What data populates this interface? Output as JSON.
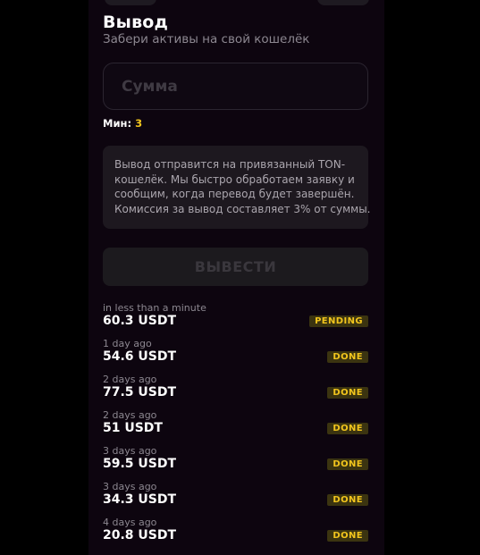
{
  "header": {
    "title": "Вывод",
    "subtitle": "Забери активы на свой кошелёк"
  },
  "amount_input": {
    "placeholder": "Сумма",
    "value": ""
  },
  "min": {
    "label": "Мин:",
    "value": "3"
  },
  "info": {
    "lines": [
      "Вывод отправится на привязанный TON-",
      "кошелёк. Мы быстро обработаем заявку и",
      "сообщим, когда перевод будет завершён.",
      "Комиссия за вывод составляет 3% от суммы."
    ]
  },
  "withdraw_button": {
    "label": "ВЫВЕСТИ"
  },
  "history": [
    {
      "time": "in less than a minute",
      "amount": "60.3 USDT",
      "status": "PENDING"
    },
    {
      "time": "1 day ago",
      "amount": "54.6 USDT",
      "status": "DONE"
    },
    {
      "time": "2 days ago",
      "amount": "77.5 USDT",
      "status": "DONE"
    },
    {
      "time": "2 days ago",
      "amount": "51 USDT",
      "status": "DONE"
    },
    {
      "time": "3 days ago",
      "amount": "59.5 USDT",
      "status": "DONE"
    },
    {
      "time": "3 days ago",
      "amount": "34.3 USDT",
      "status": "DONE"
    },
    {
      "time": "4 days ago",
      "amount": "20.8 USDT",
      "status": "DONE"
    }
  ],
  "colors": {
    "accent": "#f2c51d",
    "background": "#0d050f"
  }
}
